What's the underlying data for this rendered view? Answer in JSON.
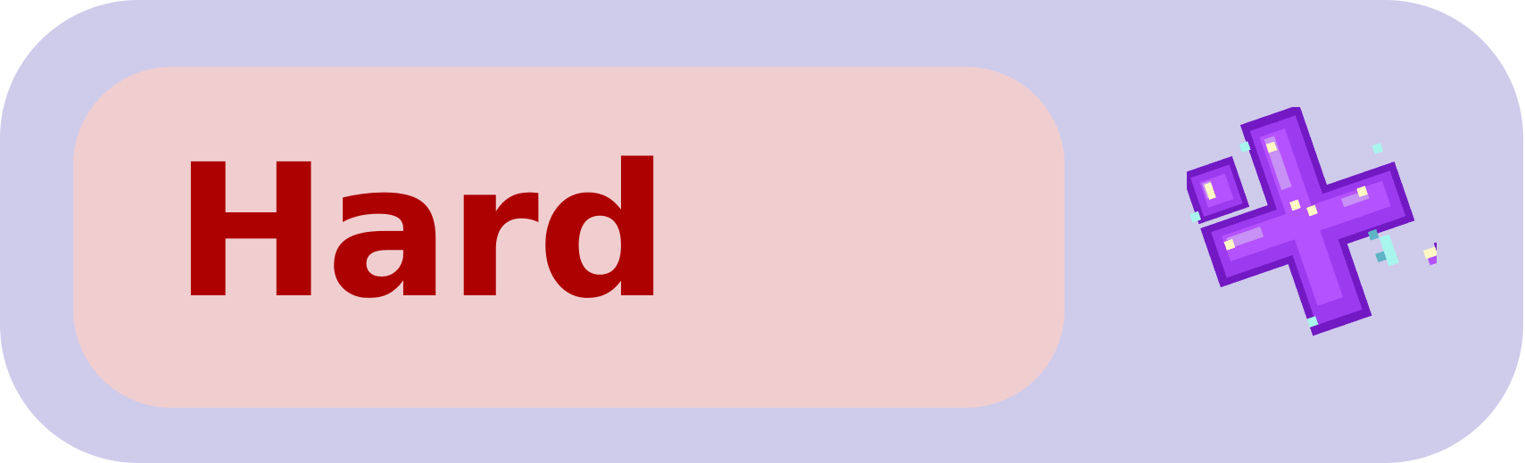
{
  "difficulty_button": {
    "label": "Hard",
    "icon": "crystal-star-icon"
  },
  "colors": {
    "button_background": "#cfcbeb",
    "label_background": "#f0ced0",
    "label_text": "#ad0000",
    "crystal_dark": "#7219c4",
    "crystal_mid": "#9c3af0",
    "crystal_light": "#b552ff",
    "crystal_pale": "#c891f5",
    "sparkle_cream": "#fff8c4",
    "sparkle_cyan": "#a8f5ee",
    "sparkle_teal": "#5fb3c4"
  }
}
